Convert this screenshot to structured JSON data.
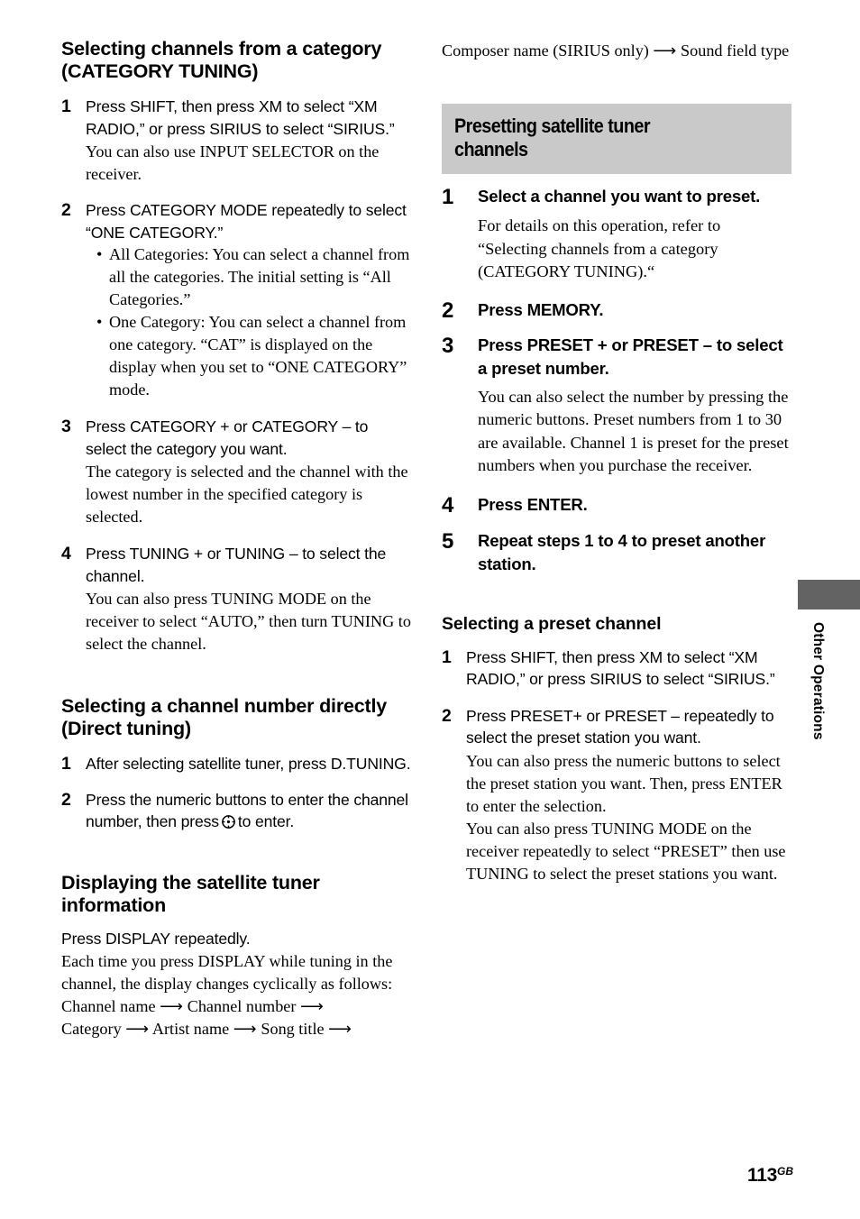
{
  "page": {
    "number": "113",
    "number_suffix": "GB",
    "edge_tab_label": "Other Operations",
    "banner_color": "#c9c9c9",
    "edge_tab_color": "#636363"
  },
  "left_column": {
    "section1": {
      "title": "Selecting channels from a category (CATEGORY TUNING)",
      "steps": [
        {
          "num": "1",
          "lead": "Press SHIFT, then press XM to select “XM RADIO,” or press SIRIUS to select “SIRIUS.”",
          "note": "You can also use INPUT SELECTOR on the receiver."
        },
        {
          "num": "2",
          "lead": "Press CATEGORY MODE repeatedly to select “ONE CATEGORY.”",
          "bullets": [
            "All Categories: You can select a channel from all the categories. The initial setting is “All Categories.”",
            "One Category: You can select a channel from one category. “CAT” is displayed on the display when you set to “ONE CATEGORY” mode."
          ]
        },
        {
          "num": "3",
          "lead": "Press CATEGORY + or CATEGORY – to select the category you want.",
          "note": "The category is selected and the channel with the lowest number in the specified category is selected."
        },
        {
          "num": "4",
          "lead": "Press TUNING + or TUNING – to select the channel.",
          "note": "You can also press TUNING MODE on the receiver to select “AUTO,” then turn TUNING to select the channel."
        }
      ]
    },
    "section2": {
      "title": "Selecting a channel number directly (Direct tuning)",
      "steps": [
        {
          "num": "1",
          "lead": "After selecting satellite tuner, press D.TUNING."
        },
        {
          "num": "2",
          "lead_part1": "Press the numeric buttons to enter the channel number, then press",
          "icon": "enter-circle-icon",
          "lead_part2": "to enter."
        }
      ]
    },
    "section3": {
      "title": "Displaying the satellite tuner information",
      "intro": "Press DISPLAY repeatedly.",
      "body": "Each time you press DISPLAY while tuning in the channel, the display changes cyclically as follows:",
      "cycle_line1": "Channel name ⟶ Channel number ⟶",
      "cycle_line2": "Category ⟶ Artist name ⟶ Song title ⟶"
    }
  },
  "right_column": {
    "continuation": "Composer name (SIRIUS only) ⟶ Sound field type",
    "banner_title": "Presetting satellite tuner\nchannels",
    "steps": [
      {
        "num": "1",
        "lead": "Select a channel you want to preset.",
        "note": "For details on this operation, refer to “Selecting channels from a category (CATEGORY TUNING).“"
      },
      {
        "num": "2",
        "lead": "Press MEMORY."
      },
      {
        "num": "3",
        "lead": "Press PRESET + or PRESET – to select a preset number.",
        "note": "You can also select the number by pressing the numeric buttons. Preset numbers from 1 to 30 are available. Channel 1 is preset for the preset numbers when you purchase the receiver."
      },
      {
        "num": "4",
        "lead": "Press ENTER."
      },
      {
        "num": "5",
        "lead": "Repeat steps 1 to 4 to preset another station."
      }
    ],
    "subsection": {
      "title": "Selecting a preset channel",
      "steps": [
        {
          "num": "1",
          "lead": "Press SHIFT, then press XM to select “XM RADIO,” or press SIRIUS to select “SIRIUS.”"
        },
        {
          "num": "2",
          "lead": "Press PRESET+ or PRESET – repeatedly to select the preset station you want.",
          "note1": "You can also press the numeric buttons to select the preset station you want. Then, press ENTER to enter the selection.",
          "note2": "You can also press TUNING MODE on the receiver repeatedly to select “PRESET” then use TUNING to select the preset stations you want."
        }
      ]
    }
  }
}
